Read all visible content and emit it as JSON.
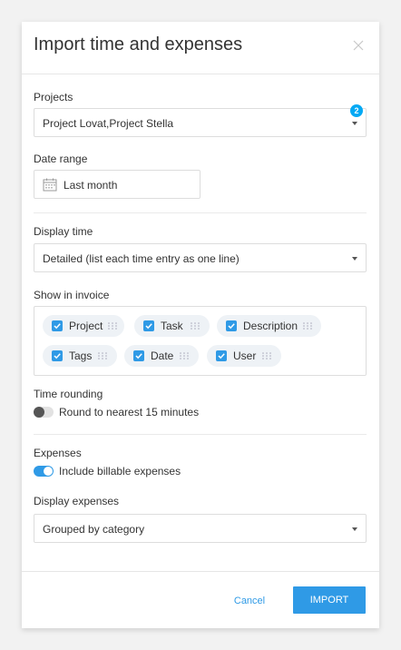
{
  "modal": {
    "title": "Import time and expenses"
  },
  "projects": {
    "label": "Projects",
    "value": "Project Lovat,Project Stella",
    "badge_count": "2"
  },
  "date_range": {
    "label": "Date range",
    "value": "Last month"
  },
  "display_time": {
    "label": "Display time",
    "value": "Detailed (list each time entry as one line)"
  },
  "show_in_invoice": {
    "label": "Show in invoice",
    "chips": [
      {
        "label": "Project",
        "checked": true
      },
      {
        "label": "Task",
        "checked": true
      },
      {
        "label": "Description",
        "checked": true
      },
      {
        "label": "Tags",
        "checked": true
      },
      {
        "label": "Date",
        "checked": true
      },
      {
        "label": "User",
        "checked": true
      }
    ]
  },
  "time_rounding": {
    "label": "Time rounding",
    "toggle_label": "Round to nearest 15 minutes",
    "enabled": false
  },
  "expenses": {
    "label": "Expenses",
    "toggle_label": "Include billable expenses",
    "enabled": true
  },
  "display_expenses": {
    "label": "Display expenses",
    "value": "Grouped by category"
  },
  "footer": {
    "cancel_label": "Cancel",
    "import_label": "IMPORT"
  },
  "colors": {
    "accent": "#2f9ae6",
    "badge": "#03a9f4"
  }
}
